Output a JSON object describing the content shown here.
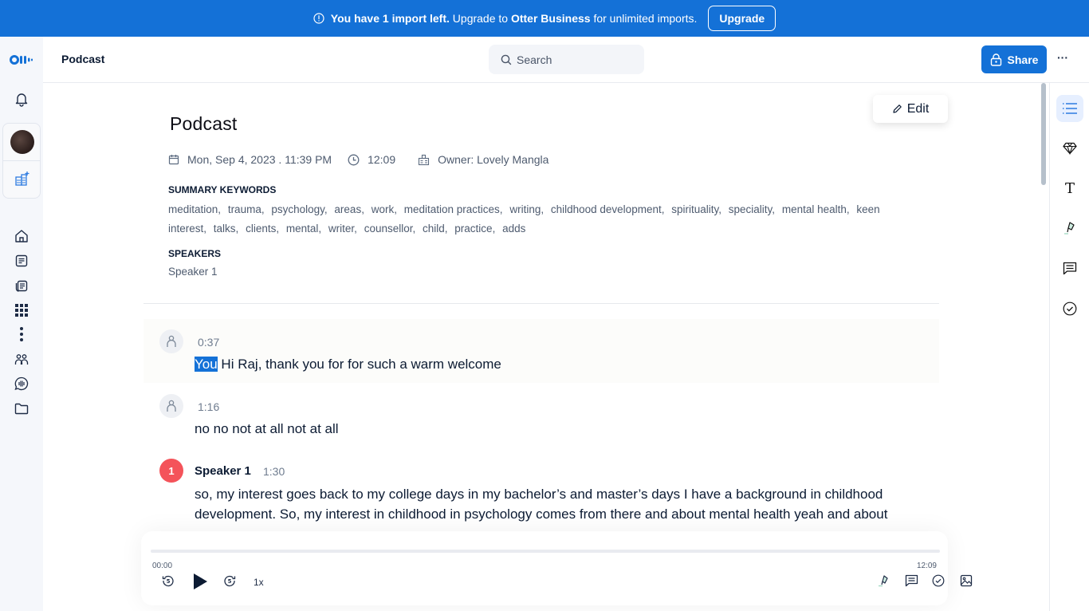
{
  "banner": {
    "message_bold": "You have 1 import left.",
    "message_mid": "Upgrade to",
    "message_brand": "Otter Business",
    "message_end": "for unlimited imports.",
    "upgrade_label": "Upgrade",
    "info_icon": "info-circle-icon"
  },
  "left_rail": {
    "logo": "otter-logo",
    "items": [
      {
        "name": "notifications",
        "icon": "bell-icon"
      },
      {
        "name": "profile",
        "icon": "avatar"
      },
      {
        "name": "add-workspace",
        "icon": "add-org-icon"
      },
      {
        "name": "home",
        "icon": "home-icon"
      },
      {
        "name": "my-notes",
        "icon": "note-icon"
      },
      {
        "name": "shared-notes",
        "icon": "notes-stack-icon"
      },
      {
        "name": "apps",
        "icon": "grid-icon"
      },
      {
        "name": "more",
        "icon": "vertical-dots-icon"
      },
      {
        "name": "people",
        "icon": "people-icon"
      },
      {
        "name": "channels",
        "icon": "audio-chat-icon"
      },
      {
        "name": "folders",
        "icon": "folder-icon"
      }
    ]
  },
  "header": {
    "title": "Podcast",
    "search_placeholder": "Search",
    "share_label": "Share",
    "more_label": "···"
  },
  "document": {
    "edit_label": "Edit",
    "title": "Podcast",
    "date": "Mon, Sep 4, 2023 . 11:39 PM",
    "duration": "12:09",
    "owner": "Owner: Lovely Mangla",
    "keywords_label": "SUMMARY KEYWORDS",
    "keywords": [
      "meditation,",
      "trauma,",
      "psychology,",
      "areas,",
      "work,",
      "meditation practices,",
      "writing,",
      "childhood development,",
      "spirituality,",
      "speciality,",
      "mental health,",
      "keen interest,",
      "talks,",
      "clients,",
      "mental,",
      "writer,",
      "counsellor,",
      "child,",
      "practice,",
      "adds"
    ],
    "speakers_label": "SPEAKERS",
    "speakers": "Speaker 1"
  },
  "transcript": [
    {
      "speaker": "",
      "time": "0:37",
      "selected": "You",
      "text": " Hi Raj, thank you for for such a warm welcome"
    },
    {
      "speaker": "",
      "time": "1:16",
      "text": "no no not at all not at all"
    },
    {
      "speaker": "Speaker 1",
      "speaker_num": "1",
      "time": "1:30",
      "text": "so, my interest goes back to my college days in my bachelor’s and master’s days I have a background in childhood development. So, my interest in childhood in psychology comes from there and about mental health yeah and about"
    }
  ],
  "player": {
    "current_time": "00:00",
    "total_time": "12:09",
    "progress": 0,
    "speed": "1x",
    "controls_left": [
      "rewind-5-icon",
      "play-icon",
      "forward-5-icon"
    ],
    "controls_right": [
      "highlight-icon",
      "comment-icon",
      "check-circle-icon",
      "image-icon"
    ]
  },
  "right_rail": {
    "items": [
      {
        "name": "outline",
        "icon": "list-icon",
        "active": true
      },
      {
        "name": "premium",
        "icon": "diamond-icon"
      },
      {
        "name": "text",
        "icon": "text-T-icon",
        "glyph": "T"
      },
      {
        "name": "highlight",
        "icon": "highlighter-icon"
      },
      {
        "name": "comments",
        "icon": "comment-icon"
      },
      {
        "name": "action-items",
        "icon": "check-circle-icon"
      }
    ]
  },
  "colors": {
    "brand_blue": "#1471d7",
    "speaker_badge": "#f4535a",
    "text_dark": "#0c1b33",
    "text_muted": "#4e5b6f"
  }
}
